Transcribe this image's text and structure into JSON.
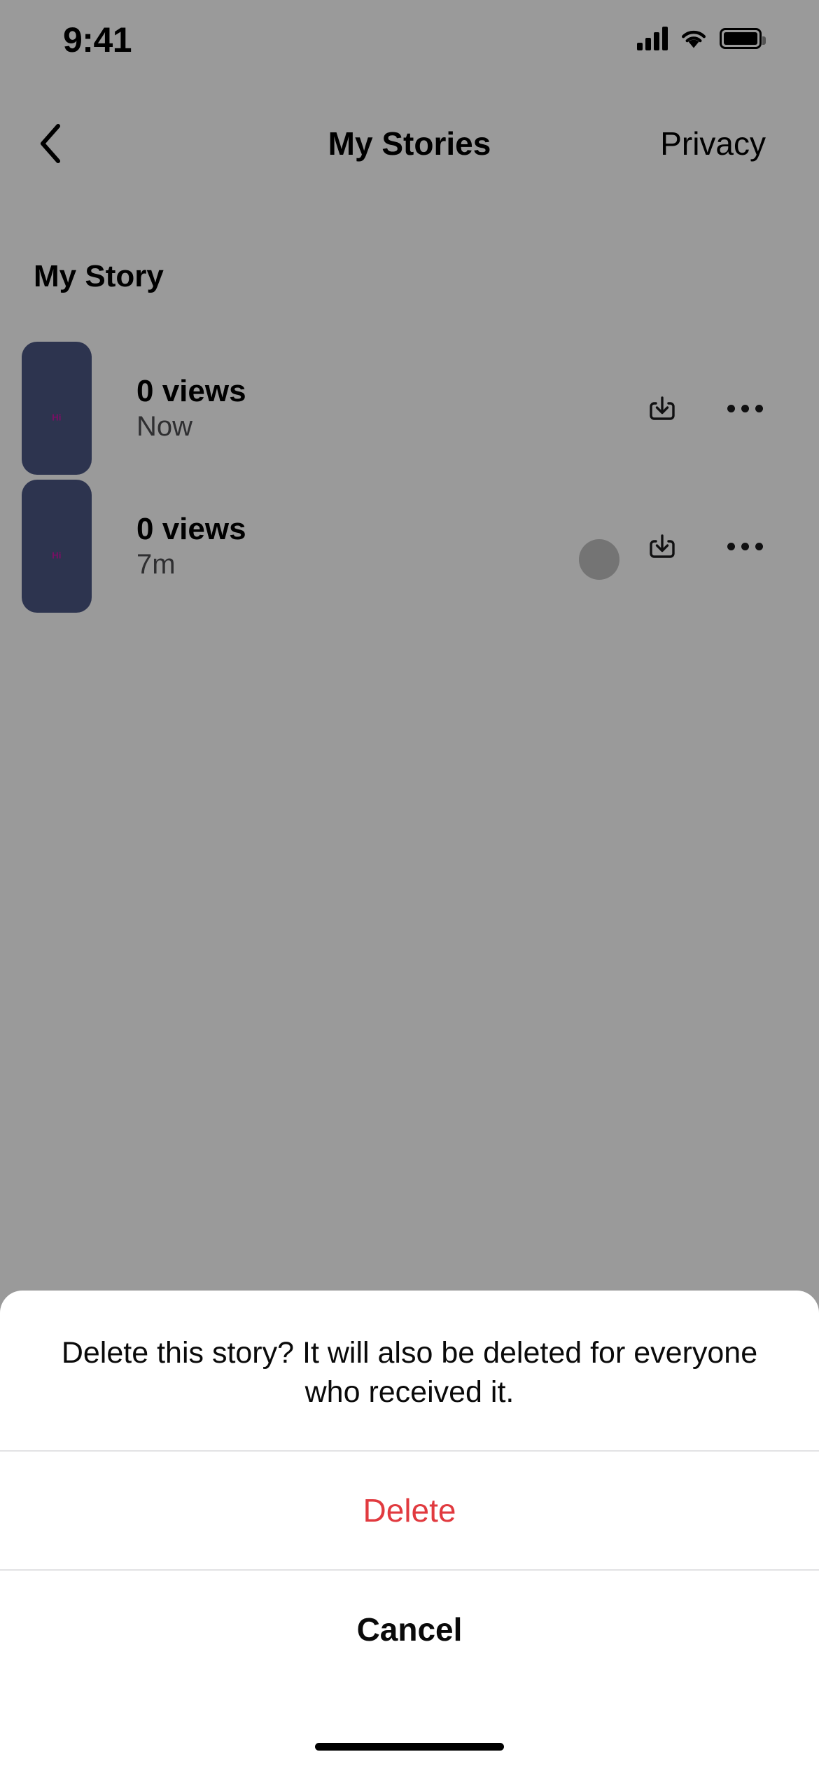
{
  "status_bar": {
    "time": "9:41",
    "cellular_icon": "signal-bars-icon",
    "wifi_icon": "wifi-icon",
    "battery_icon": "battery-icon"
  },
  "nav": {
    "back_icon": "chevron-left-icon",
    "title": "My Stories",
    "action_label": "Privacy"
  },
  "content": {
    "section_title": "My Story",
    "stories": [
      {
        "thumbnail_label": "Hi",
        "thumbnail_color": "#4b5683",
        "thumbnail_text_color": "#cc18a6",
        "views": "0 views",
        "time": "Now",
        "save_icon": "download-icon",
        "more_icon": "ellipsis-icon"
      },
      {
        "thumbnail_label": "Hi",
        "thumbnail_color": "#4b5683",
        "thumbnail_text_color": "#cc18a6",
        "views": "0 views",
        "time": "7m",
        "save_icon": "download-icon",
        "more_icon": "ellipsis-icon"
      }
    ]
  },
  "tap_indicator": {
    "name": "touch-point-indicator"
  },
  "action_sheet": {
    "message": "Delete this story? It will also be deleted for everyone who received it.",
    "destructive_label": "Delete",
    "destructive_color": "#e13a3f",
    "cancel_label": "Cancel"
  },
  "home_indicator": {
    "name": "home-indicator"
  }
}
